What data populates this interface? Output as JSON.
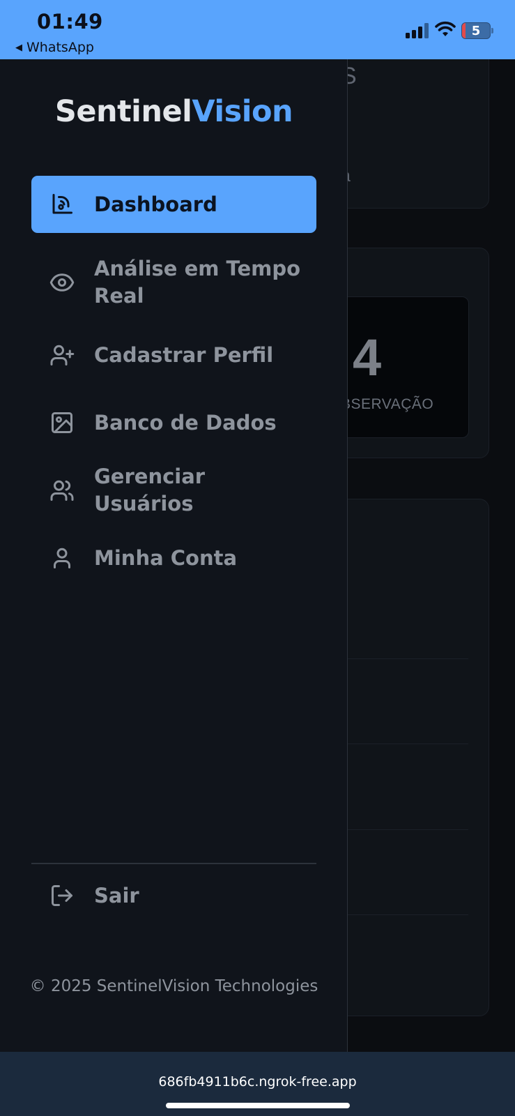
{
  "status_bar": {
    "time": "01:49",
    "back_app": "WhatsApp",
    "back_icon": "back-triangle-icon",
    "battery_level": "5",
    "icons": [
      "signal-icon",
      "wifi-icon",
      "battery-icon"
    ]
  },
  "drawer": {
    "brand_part1": "Sentinel",
    "brand_part2": "Vision",
    "nav": [
      {
        "label": "Dashboard",
        "icon": "dashboard-icon",
        "active": true
      },
      {
        "label": "Análise em Tempo Real",
        "icon": "eye-icon",
        "active": false
      },
      {
        "label": "Cadastrar Perfil",
        "icon": "user-plus-icon",
        "active": false
      },
      {
        "label": "Banco de Dados",
        "icon": "image-icon",
        "active": false
      },
      {
        "label": "Gerenciar Usuários",
        "icon": "users-icon",
        "active": false
      },
      {
        "label": "Minha Conta",
        "icon": "user-icon",
        "active": false
      }
    ],
    "logout_label": "Sair",
    "logout_icon": "logout-icon",
    "copyright": "© 2025 SentinelVision Technologies"
  },
  "background_page": {
    "partial_title": "S",
    "partial_subtitle": "a",
    "stat_value": "4",
    "stat_label": "BSERVAÇÃO"
  },
  "browser": {
    "url": "686fb4911b6c.ngrok-free.app"
  },
  "colors": {
    "accent": "#59a4fd",
    "drawer_bg": "#10141b",
    "text_muted": "#8e949d"
  }
}
